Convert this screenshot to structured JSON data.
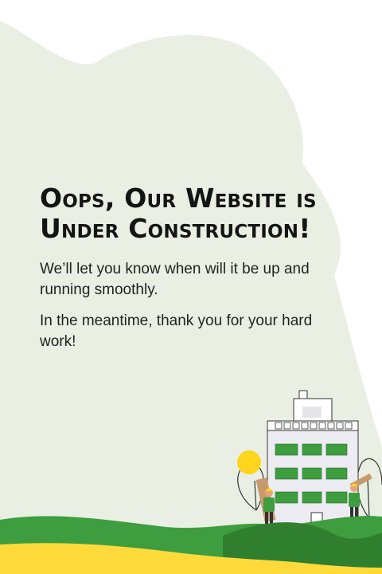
{
  "heading": {
    "line1": "Oops, Our Website is",
    "line2": "Under Construction!"
  },
  "message": {
    "paragraph1": "We’ll let you know when will it be up and running smoothly.",
    "paragraph2": "In the meantime, thank you for your hard work!"
  },
  "colors": {
    "blob": "#E9F0E3",
    "text": "#141414",
    "green": "#3E9D3F",
    "dark_green": "#2F7F2F",
    "yellow": "#FEDB3A",
    "sun": "#FFD51D"
  },
  "illustration": {
    "subject": "building-under-construction",
    "icons": [
      "building-icon",
      "worker-icon",
      "sun-icon",
      "tree-icon"
    ]
  }
}
